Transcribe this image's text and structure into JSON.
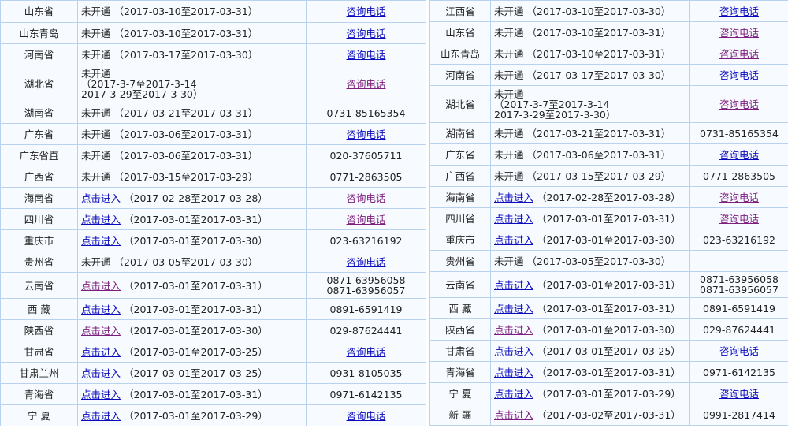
{
  "left_rows": [
    {
      "province": "山东省",
      "status": "未开通",
      "status_link": false,
      "date": "（2017-03-10至2017-03-31）",
      "phone": "咨询电话",
      "phone_link": true,
      "phone_visited": false,
      "h": 28
    },
    {
      "province": "山东青岛",
      "status": "未开通",
      "status_link": false,
      "date": "（2017-03-10至2017-03-31）",
      "phone": "咨询电话",
      "phone_link": true,
      "phone_visited": false,
      "h": 27
    },
    {
      "province": "河南省",
      "status": "未开通",
      "status_link": false,
      "date": "（2017-03-17至2017-03-30）",
      "phone": "咨询电话",
      "phone_link": true,
      "phone_visited": false,
      "h": 27
    },
    {
      "province": "湖北省",
      "status": "未开通",
      "status_link": false,
      "date": "（2017-3-7至2017-3-14\n2017-3-29至2017-3-30）",
      "phone": "咨询电话",
      "phone_link": true,
      "phone_visited": true,
      "h": 47
    },
    {
      "province": "湖南省",
      "status": "未开通",
      "status_link": false,
      "date": "（2017-03-21至2017-03-31）",
      "phone": "0731-85165354",
      "phone_link": false,
      "phone_visited": false,
      "h": 27
    },
    {
      "province": "广东省",
      "status": "未开通",
      "status_link": false,
      "date": "（2017-03-06至2017-03-31）",
      "phone": "咨询电话",
      "phone_link": true,
      "phone_visited": false,
      "h": 27
    },
    {
      "province": "广东省直",
      "status": "未开通",
      "status_link": false,
      "date": "（2017-03-06至2017-03-31）",
      "phone": "020-37605711",
      "phone_link": false,
      "phone_visited": false,
      "h": 27
    },
    {
      "province": "广西省",
      "status": "未开通",
      "status_link": false,
      "date": "（2017-03-15至2017-03-29）",
      "phone": "0771-2863505",
      "phone_link": false,
      "phone_visited": false,
      "h": 27
    },
    {
      "province": "海南省",
      "status": "点击进入",
      "status_link": true,
      "status_visited": false,
      "date": "（2017-02-28至2017-03-28）",
      "phone": "咨询电话",
      "phone_link": true,
      "phone_visited": true,
      "h": 27
    },
    {
      "province": "四川省",
      "status": "点击进入",
      "status_link": true,
      "status_visited": false,
      "date": "（2017-03-01至2017-03-31）",
      "phone": "咨询电话",
      "phone_link": true,
      "phone_visited": true,
      "h": 27
    },
    {
      "province": "重庆市",
      "status": "点击进入",
      "status_link": true,
      "status_visited": false,
      "date": "（2017-03-01至2017-03-30）",
      "phone": "023-63216192",
      "phone_link": false,
      "phone_visited": false,
      "h": 27
    },
    {
      "province": "贵州省",
      "status": "未开通",
      "status_link": false,
      "date": "（2017-03-05至2017-03-30）",
      "phone": "咨询电话",
      "phone_link": true,
      "phone_visited": false,
      "h": 27
    },
    {
      "province": "云南省",
      "status": "点击进入",
      "status_link": true,
      "status_visited": true,
      "date": "（2017-03-01至2017-03-31）",
      "phone": "0871-63956058\n0871-63956057",
      "phone_link": false,
      "phone_visited": false,
      "h": 33
    },
    {
      "province": "西 藏",
      "status": "点击进入",
      "status_link": true,
      "status_visited": false,
      "date": "（2017-03-01至2017-03-31）",
      "phone": "0891-6591419",
      "phone_link": false,
      "phone_visited": false,
      "h": 27
    },
    {
      "province": "陕西省",
      "status": "点击进入",
      "status_link": true,
      "status_visited": true,
      "date": "（2017-03-01至2017-03-30）",
      "phone": "029-87624441",
      "phone_link": false,
      "phone_visited": false,
      "h": 27
    },
    {
      "province": "甘肃省",
      "status": "点击进入",
      "status_link": true,
      "status_visited": false,
      "date": "（2017-03-01至2017-03-25）",
      "phone": "咨询电话",
      "phone_link": true,
      "phone_visited": false,
      "h": 27
    },
    {
      "province": "甘肃兰州",
      "status": "点击进入",
      "status_link": true,
      "status_visited": false,
      "date": "（2017-03-01至2017-03-25）",
      "phone": "0931-8105035",
      "phone_link": false,
      "phone_visited": false,
      "h": 27
    },
    {
      "province": "青海省",
      "status": "点击进入",
      "status_link": true,
      "status_visited": false,
      "date": "（2017-03-01至2017-03-31）",
      "phone": "0971-6142135",
      "phone_link": false,
      "phone_visited": false,
      "h": 27
    },
    {
      "province": "宁 夏",
      "status": "点击进入",
      "status_link": true,
      "status_visited": false,
      "date": "（2017-03-01至2017-03-29）",
      "phone": "咨询电话",
      "phone_link": true,
      "phone_visited": false,
      "h": 27
    }
  ],
  "right_rows": [
    {
      "province": "江西省",
      "status": "未开通",
      "status_link": false,
      "date": "（2017-03-10至2017-03-30）",
      "phone": "咨询电话",
      "phone_link": true,
      "phone_visited": false,
      "h": 27
    },
    {
      "province": "山东省",
      "status": "未开通",
      "status_link": false,
      "date": "（2017-03-10至2017-03-31）",
      "phone": "咨询电话",
      "phone_link": true,
      "phone_visited": true,
      "h": 27
    },
    {
      "province": "山东青岛",
      "status": "未开通",
      "status_link": false,
      "date": "（2017-03-10至2017-03-31）",
      "phone": "咨询电话",
      "phone_link": true,
      "phone_visited": true,
      "h": 27
    },
    {
      "province": "河南省",
      "status": "未开通",
      "status_link": false,
      "date": "（2017-03-17至2017-03-30）",
      "phone": "咨询电话",
      "phone_link": true,
      "phone_visited": false,
      "h": 27
    },
    {
      "province": "湖北省",
      "status": "未开通",
      "status_link": false,
      "date": "（2017-3-7至2017-3-14\n2017-3-29至2017-3-30）",
      "phone": "咨询电话",
      "phone_link": true,
      "phone_visited": true,
      "h": 47
    },
    {
      "province": "湖南省",
      "status": "未开通",
      "status_link": false,
      "date": "（2017-03-21至2017-03-31）",
      "phone": "0731-85165354",
      "phone_link": false,
      "phone_visited": false,
      "h": 27
    },
    {
      "province": "广东省",
      "status": "未开通",
      "status_link": false,
      "date": "（2017-03-06至2017-03-31）",
      "phone": "咨询电话",
      "phone_link": true,
      "phone_visited": false,
      "h": 27
    },
    {
      "province": "广西省",
      "status": "未开通",
      "status_link": false,
      "date": "（2017-03-15至2017-03-29）",
      "phone": "0771-2863505",
      "phone_link": false,
      "phone_visited": false,
      "h": 27
    },
    {
      "province": "海南省",
      "status": "点击进入",
      "status_link": true,
      "status_visited": false,
      "date": "（2017-02-28至2017-03-28）",
      "phone": "咨询电话",
      "phone_link": true,
      "phone_visited": true,
      "h": 27
    },
    {
      "province": "四川省",
      "status": "点击进入",
      "status_link": true,
      "status_visited": false,
      "date": "（2017-03-01至2017-03-31）",
      "phone": "咨询电话",
      "phone_link": true,
      "phone_visited": true,
      "h": 27
    },
    {
      "province": "重庆市",
      "status": "点击进入",
      "status_link": true,
      "status_visited": false,
      "date": "（2017-03-01至2017-03-30）",
      "phone": "023-63216192",
      "phone_link": false,
      "phone_visited": false,
      "h": 27
    },
    {
      "province": "贵州省",
      "status": "未开通",
      "status_link": false,
      "date": "（2017-03-05至2017-03-30）",
      "phone": "",
      "phone_link": false,
      "phone_visited": false,
      "h": 27
    },
    {
      "province": "云南省",
      "status": "点击进入",
      "status_link": true,
      "status_visited": false,
      "date": "（2017-03-01至2017-03-31）",
      "phone": "0871-63956058\n0871-63956057",
      "phone_link": false,
      "phone_visited": false,
      "h": 33
    },
    {
      "province": "西 藏",
      "status": "点击进入",
      "status_link": true,
      "status_visited": false,
      "date": "（2017-03-01至2017-03-31）",
      "phone": "0891-6591419",
      "phone_link": false,
      "phone_visited": false,
      "h": 27
    },
    {
      "province": "陕西省",
      "status": "点击进入",
      "status_link": true,
      "status_visited": true,
      "date": "（2017-03-01至2017-03-30）",
      "phone": "029-87624441",
      "phone_link": false,
      "phone_visited": false,
      "h": 27
    },
    {
      "province": "甘肃省",
      "status": "点击进入",
      "status_link": true,
      "status_visited": false,
      "date": "（2017-03-01至2017-03-25）",
      "phone": "咨询电话",
      "phone_link": true,
      "phone_visited": false,
      "h": 27
    },
    {
      "province": "青海省",
      "status": "点击进入",
      "status_link": true,
      "status_visited": false,
      "date": "（2017-03-01至2017-03-31）",
      "phone": "0971-6142135",
      "phone_link": false,
      "phone_visited": false,
      "h": 27
    },
    {
      "province": "宁 夏",
      "status": "点击进入",
      "status_link": true,
      "status_visited": false,
      "date": "（2017-03-01至2017-03-29）",
      "phone": "咨询电话",
      "phone_link": true,
      "phone_visited": false,
      "h": 27
    },
    {
      "province": "新 疆",
      "status": "点击进入",
      "status_link": true,
      "status_visited": true,
      "date": "（2017-03-02至2017-03-31）",
      "phone": "0991-2817414",
      "phone_link": false,
      "phone_visited": false,
      "h": 27
    }
  ],
  "colors": {
    "border": "#b9d2ee",
    "link": "#0b0bbd",
    "visited": "#7d1d7d",
    "cell_bg": "#f7fbff"
  }
}
